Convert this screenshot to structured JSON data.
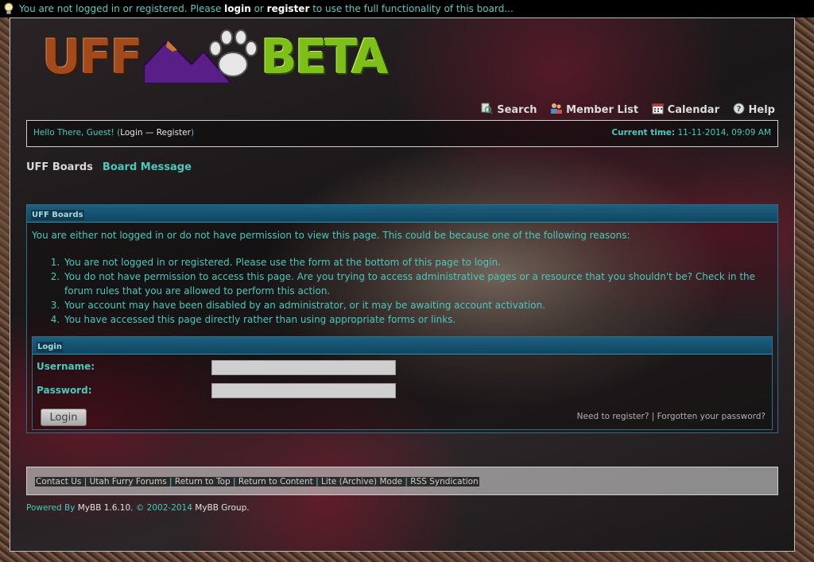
{
  "notice": {
    "prefix": "You are not logged in or registered. Please ",
    "login": "login",
    "or": " or ",
    "register": "register",
    "suffix": " to use the full functionality of this board..."
  },
  "logo": {
    "uff": "UFF",
    "beta": "BETA"
  },
  "menu": [
    {
      "label": "Search",
      "icon": "search-icon"
    },
    {
      "label": "Member List",
      "icon": "member-list-icon"
    },
    {
      "label": "Calendar",
      "icon": "calendar-icon"
    },
    {
      "label": "Help",
      "icon": "help-icon"
    }
  ],
  "panel": {
    "greeting": "Hello There, Guest! (",
    "login": "Login",
    "dash": " — ",
    "register": "Register",
    "close": ")",
    "time_label": "Current time:",
    "time_value": " 11-11-2014, 09:09 AM"
  },
  "breadcrumb": {
    "home": "UFF Boards",
    "current": "Board Message"
  },
  "error": {
    "header": "UFF Boards",
    "intro": "You are either not logged in or do not have permission to view this page. This could be because one of the following reasons:",
    "reasons": [
      "You are not logged in or registered. Please use the form at the bottom of this page to login.",
      "You do not have permission to access this page. Are you trying to access administrative pages or a resource that you shouldn't be? Check in the forum rules that you are allowed to perform this action.",
      "Your account may have been disabled by an administrator, or it may be awaiting account activation.",
      "You have accessed this page directly rather than using appropriate forms or links."
    ]
  },
  "login": {
    "header": "Login",
    "username_label": "Username:",
    "password_label": "Password:",
    "username_value": "",
    "password_value": "",
    "button": "Login",
    "need_register": "Need to register?",
    "separator": " | ",
    "forgot": "Forgotten your password?"
  },
  "footer": {
    "links": [
      "Contact Us",
      "Utah Furry Forums",
      "Return to Top",
      "Return to Content",
      "Lite (Archive) Mode",
      "RSS Syndication"
    ],
    "powered_by": "Powered By ",
    "mybb": "MyBB 1.6.10",
    "comma": ", ",
    "copyright": "© 2002-2014",
    "group": " MyBB Group."
  },
  "colors": {
    "accent": "#4cc7bd",
    "header_bar": "#1c5f80",
    "notice_bg": "#000000"
  }
}
